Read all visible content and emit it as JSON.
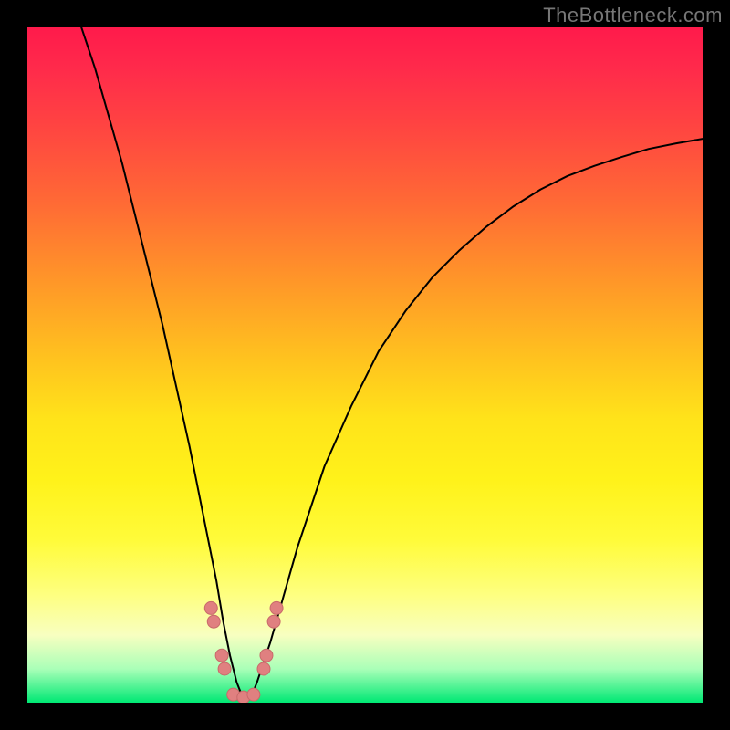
{
  "watermark": "TheBottleneck.com",
  "chart_data": {
    "type": "line",
    "title": "",
    "xlabel": "",
    "ylabel": "",
    "xlim": [
      0,
      100
    ],
    "ylim": [
      0,
      100
    ],
    "series": [
      {
        "name": "curve",
        "x": [
          8,
          10,
          12,
          14,
          16,
          18,
          20,
          22,
          24,
          26,
          28,
          29,
          30,
          31,
          32,
          33,
          34,
          36,
          38,
          40,
          44,
          48,
          52,
          56,
          60,
          64,
          68,
          72,
          76,
          80,
          84,
          88,
          92,
          96,
          100
        ],
        "values": [
          100,
          94,
          87,
          80,
          72,
          64,
          56,
          47,
          38,
          28,
          18,
          12,
          7,
          3,
          0.5,
          0.5,
          3,
          9,
          16,
          23,
          35,
          44,
          52,
          58,
          63,
          67,
          70.5,
          73.5,
          76,
          78,
          79.5,
          80.8,
          82,
          82.8,
          83.5
        ]
      }
    ],
    "markers": [
      {
        "x": 27.2,
        "y": 14
      },
      {
        "x": 27.6,
        "y": 12
      },
      {
        "x": 28.8,
        "y": 7
      },
      {
        "x": 29.2,
        "y": 5
      },
      {
        "x": 30.5,
        "y": 1.2
      },
      {
        "x": 32,
        "y": 0.8
      },
      {
        "x": 33.5,
        "y": 1.2
      },
      {
        "x": 35,
        "y": 5
      },
      {
        "x": 35.4,
        "y": 7
      },
      {
        "x": 36.5,
        "y": 12
      },
      {
        "x": 36.9,
        "y": 14
      }
    ],
    "background_gradient": {
      "top": "#ff1a4b",
      "bottom": "#00e874"
    }
  }
}
